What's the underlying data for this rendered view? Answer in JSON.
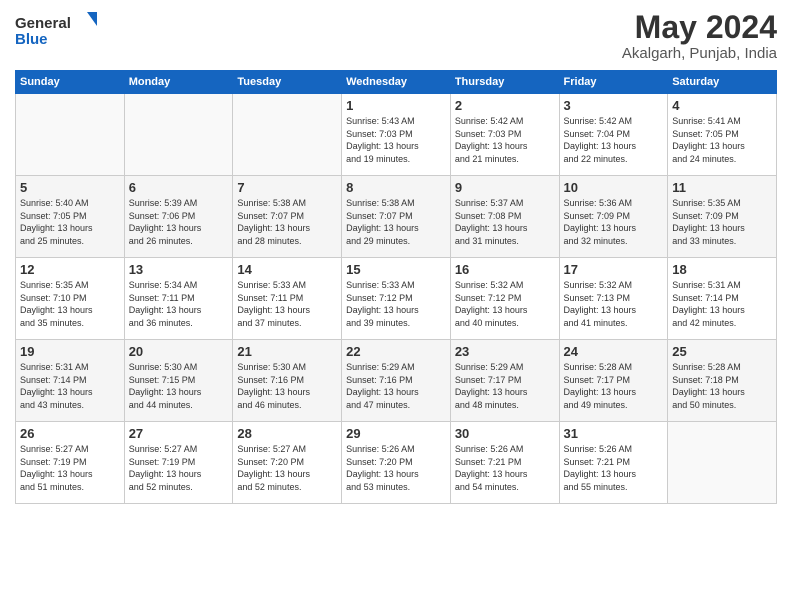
{
  "header": {
    "logo_general": "General",
    "logo_blue": "Blue",
    "title": "May 2024",
    "subtitle": "Akalgarh, Punjab, India"
  },
  "columns": [
    "Sunday",
    "Monday",
    "Tuesday",
    "Wednesday",
    "Thursday",
    "Friday",
    "Saturday"
  ],
  "weeks": [
    [
      {
        "day": "",
        "info": ""
      },
      {
        "day": "",
        "info": ""
      },
      {
        "day": "",
        "info": ""
      },
      {
        "day": "1",
        "info": "Sunrise: 5:43 AM\nSunset: 7:03 PM\nDaylight: 13 hours\nand 19 minutes."
      },
      {
        "day": "2",
        "info": "Sunrise: 5:42 AM\nSunset: 7:03 PM\nDaylight: 13 hours\nand 21 minutes."
      },
      {
        "day": "3",
        "info": "Sunrise: 5:42 AM\nSunset: 7:04 PM\nDaylight: 13 hours\nand 22 minutes."
      },
      {
        "day": "4",
        "info": "Sunrise: 5:41 AM\nSunset: 7:05 PM\nDaylight: 13 hours\nand 24 minutes."
      }
    ],
    [
      {
        "day": "5",
        "info": "Sunrise: 5:40 AM\nSunset: 7:05 PM\nDaylight: 13 hours\nand 25 minutes."
      },
      {
        "day": "6",
        "info": "Sunrise: 5:39 AM\nSunset: 7:06 PM\nDaylight: 13 hours\nand 26 minutes."
      },
      {
        "day": "7",
        "info": "Sunrise: 5:38 AM\nSunset: 7:07 PM\nDaylight: 13 hours\nand 28 minutes."
      },
      {
        "day": "8",
        "info": "Sunrise: 5:38 AM\nSunset: 7:07 PM\nDaylight: 13 hours\nand 29 minutes."
      },
      {
        "day": "9",
        "info": "Sunrise: 5:37 AM\nSunset: 7:08 PM\nDaylight: 13 hours\nand 31 minutes."
      },
      {
        "day": "10",
        "info": "Sunrise: 5:36 AM\nSunset: 7:09 PM\nDaylight: 13 hours\nand 32 minutes."
      },
      {
        "day": "11",
        "info": "Sunrise: 5:35 AM\nSunset: 7:09 PM\nDaylight: 13 hours\nand 33 minutes."
      }
    ],
    [
      {
        "day": "12",
        "info": "Sunrise: 5:35 AM\nSunset: 7:10 PM\nDaylight: 13 hours\nand 35 minutes."
      },
      {
        "day": "13",
        "info": "Sunrise: 5:34 AM\nSunset: 7:11 PM\nDaylight: 13 hours\nand 36 minutes."
      },
      {
        "day": "14",
        "info": "Sunrise: 5:33 AM\nSunset: 7:11 PM\nDaylight: 13 hours\nand 37 minutes."
      },
      {
        "day": "15",
        "info": "Sunrise: 5:33 AM\nSunset: 7:12 PM\nDaylight: 13 hours\nand 39 minutes."
      },
      {
        "day": "16",
        "info": "Sunrise: 5:32 AM\nSunset: 7:12 PM\nDaylight: 13 hours\nand 40 minutes."
      },
      {
        "day": "17",
        "info": "Sunrise: 5:32 AM\nSunset: 7:13 PM\nDaylight: 13 hours\nand 41 minutes."
      },
      {
        "day": "18",
        "info": "Sunrise: 5:31 AM\nSunset: 7:14 PM\nDaylight: 13 hours\nand 42 minutes."
      }
    ],
    [
      {
        "day": "19",
        "info": "Sunrise: 5:31 AM\nSunset: 7:14 PM\nDaylight: 13 hours\nand 43 minutes."
      },
      {
        "day": "20",
        "info": "Sunrise: 5:30 AM\nSunset: 7:15 PM\nDaylight: 13 hours\nand 44 minutes."
      },
      {
        "day": "21",
        "info": "Sunrise: 5:30 AM\nSunset: 7:16 PM\nDaylight: 13 hours\nand 46 minutes."
      },
      {
        "day": "22",
        "info": "Sunrise: 5:29 AM\nSunset: 7:16 PM\nDaylight: 13 hours\nand 47 minutes."
      },
      {
        "day": "23",
        "info": "Sunrise: 5:29 AM\nSunset: 7:17 PM\nDaylight: 13 hours\nand 48 minutes."
      },
      {
        "day": "24",
        "info": "Sunrise: 5:28 AM\nSunset: 7:17 PM\nDaylight: 13 hours\nand 49 minutes."
      },
      {
        "day": "25",
        "info": "Sunrise: 5:28 AM\nSunset: 7:18 PM\nDaylight: 13 hours\nand 50 minutes."
      }
    ],
    [
      {
        "day": "26",
        "info": "Sunrise: 5:27 AM\nSunset: 7:19 PM\nDaylight: 13 hours\nand 51 minutes."
      },
      {
        "day": "27",
        "info": "Sunrise: 5:27 AM\nSunset: 7:19 PM\nDaylight: 13 hours\nand 52 minutes."
      },
      {
        "day": "28",
        "info": "Sunrise: 5:27 AM\nSunset: 7:20 PM\nDaylight: 13 hours\nand 52 minutes."
      },
      {
        "day": "29",
        "info": "Sunrise: 5:26 AM\nSunset: 7:20 PM\nDaylight: 13 hours\nand 53 minutes."
      },
      {
        "day": "30",
        "info": "Sunrise: 5:26 AM\nSunset: 7:21 PM\nDaylight: 13 hours\nand 54 minutes."
      },
      {
        "day": "31",
        "info": "Sunrise: 5:26 AM\nSunset: 7:21 PM\nDaylight: 13 hours\nand 55 minutes."
      },
      {
        "day": "",
        "info": ""
      }
    ]
  ]
}
